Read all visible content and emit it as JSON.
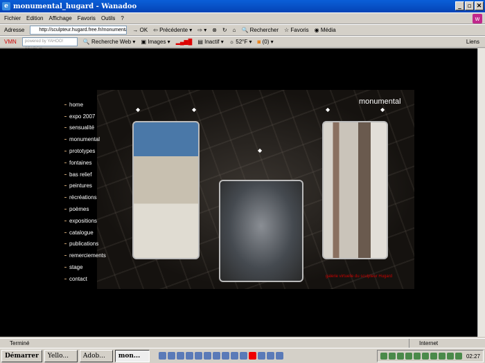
{
  "window": {
    "title": "monumental_hugard - Wanadoo"
  },
  "menu": [
    "Fichier",
    "Edition",
    "Affichage",
    "Favoris",
    "Outils",
    "?"
  ],
  "address": {
    "label": "Adresse",
    "url": "http://sculpteur.hugard.free.fr/monumental.html",
    "go": "OK"
  },
  "nav_toolbar": {
    "back": "Précédente",
    "search": "Rechercher",
    "favorites": "Favoris",
    "media": "Média"
  },
  "links_toolbar": {
    "logo": "VMN",
    "search_placeholder": "powered by YAHOO! SEARCH",
    "web_search": "Recherche Web",
    "images": "Images",
    "status": "Inactif",
    "weather": "52°F",
    "rss": "(0)",
    "links": "Liens"
  },
  "site": {
    "title": "monumental",
    "credit": "galerie virtuelle du sculpteur Hugard",
    "nav": [
      "home",
      "expo 2007",
      "sensualité",
      "monumental",
      "prototypes",
      "fontaines",
      "bas relief",
      "peintures",
      "récréations",
      "poèmes",
      "expositions",
      "catalogue",
      "publications",
      "remerciements",
      "stage",
      "contact"
    ]
  },
  "statusbar": {
    "text": "Terminé",
    "zone": "Internet"
  },
  "taskbar": {
    "start": "Démarrer",
    "tasks": [
      "Yello...",
      "Adob...",
      "mon..."
    ],
    "clock": "02:27"
  }
}
